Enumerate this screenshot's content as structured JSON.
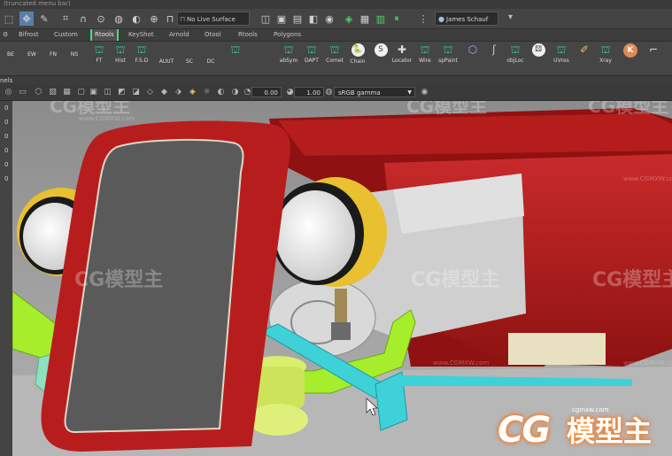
{
  "app": {
    "status_menu": "(truncated menu bar)"
  },
  "toolbar": {
    "live_surface": "No Live Surface",
    "user": "James Schauf"
  },
  "shelf_tabs": [
    "Bifrost",
    "Custom",
    "Rtools",
    "KeyShot",
    "Arnold",
    "Otool",
    "Rtools",
    "Polygons"
  ],
  "shelf_selected_index": 2,
  "shelf_buttons_left": [
    "BE",
    "EW",
    "FN",
    "NS",
    "FT",
    "Hist",
    "F.S.D",
    "AUUT",
    "SC",
    "DC"
  ],
  "shelf_buttons_right": [
    "abSym",
    "DAPT",
    "Comet",
    "Chain",
    "Locator",
    "Wire",
    "spPaint",
    "objLoc",
    "UVres",
    "Xray"
  ],
  "panel_menu": "nels",
  "viewport_toolbar": {
    "exposure": "0.00",
    "gamma": "1.00",
    "color_space": "sRGB gamma"
  },
  "channel_values": [
    "0",
    "0",
    "0",
    "0",
    "0",
    "0"
  ],
  "watermark": {
    "logo_text": "CG模型主",
    "site": "www.CGMXW.com",
    "brand_url": "cgmxw.com"
  }
}
